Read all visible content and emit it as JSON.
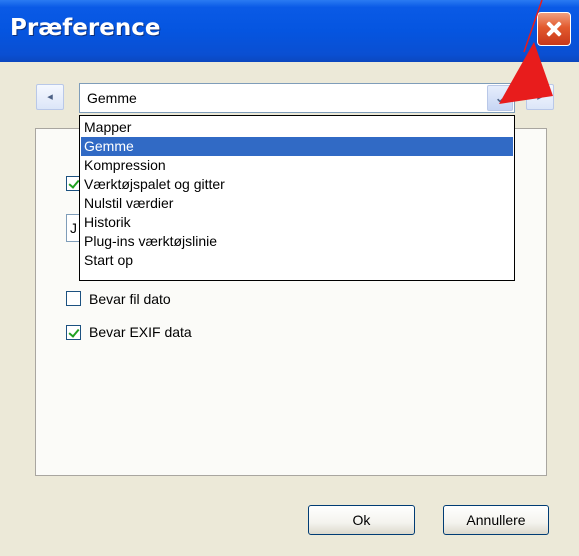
{
  "window": {
    "title": "Præference"
  },
  "navigation": {
    "prev_label": "◂",
    "next_label": "▸"
  },
  "combo": {
    "value": "Gemme",
    "arrow_label": "⌄"
  },
  "dropdown": {
    "items": [
      {
        "label": "Mapper",
        "selected": false
      },
      {
        "label": "Gemme",
        "selected": true
      },
      {
        "label": "Kompression",
        "selected": false
      },
      {
        "label": "Værktøjspalet og gitter",
        "selected": false
      },
      {
        "label": "Nulstil værdier",
        "selected": false
      },
      {
        "label": "Historik",
        "selected": false
      },
      {
        "label": "Plug-ins værktøjslinie",
        "selected": false
      },
      {
        "label": "Start op",
        "selected": false
      }
    ]
  },
  "options": {
    "partial_field_char": "J",
    "bevar_fil_dato": {
      "label": "Bevar fil dato",
      "checked": false
    },
    "bevar_exif": {
      "label": "Bevar EXIF data",
      "checked": true
    }
  },
  "buttons": {
    "ok": "Ok",
    "cancel": "Annullere"
  },
  "colors": {
    "titlebar": "#0555e0",
    "selection": "#316ac5",
    "annotation_arrow": "#e81c1c"
  }
}
